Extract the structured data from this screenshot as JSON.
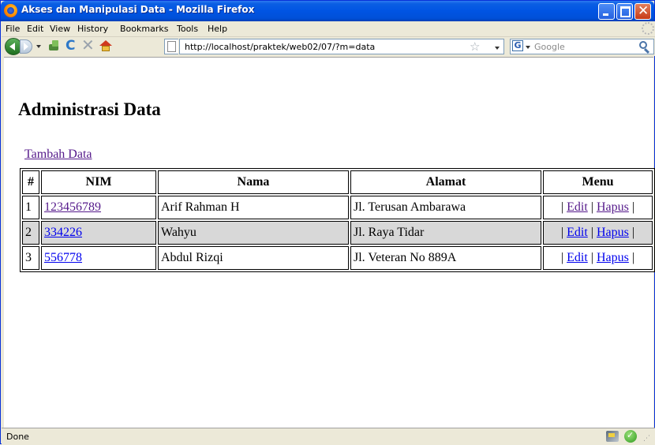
{
  "window": {
    "title": "Akses dan Manipulasi Data - Mozilla Firefox"
  },
  "menubar": [
    "File",
    "Edit",
    "View",
    "History",
    "Bookmarks",
    "Tools",
    "Help"
  ],
  "navbar": {
    "url": "http://localhost/praktek/web02/07/?m=data",
    "search_placeholder": "Google"
  },
  "page": {
    "heading": "Administrasi Data",
    "add_link": "Tambah Data",
    "table": {
      "headers": [
        "#",
        "NIM",
        "Nama",
        "Alamat",
        "Menu"
      ],
      "rows": [
        {
          "no": "1",
          "nim": "123456789",
          "nama": "Arif Rahman H",
          "alamat": "Jl. Terusan Ambarawa"
        },
        {
          "no": "2",
          "nim": "334226",
          "nama": "Wahyu",
          "alamat": "Jl. Raya Tidar"
        },
        {
          "no": "3",
          "nim": "556778",
          "nama": "Abdul Rizqi",
          "alamat": "Jl. Veteran No 889A"
        }
      ],
      "edit_label": "Edit",
      "delete_label": "Hapus",
      "separator": "|"
    }
  },
  "status": {
    "text": "Done"
  },
  "icons": {
    "firefox": "firefox-icon",
    "back": "back-arrow-icon",
    "forward": "forward-arrow-icon",
    "bookmark": "bookmark-icon",
    "reload": "reload-icon",
    "stop": "stop-icon",
    "home": "home-icon",
    "star": "star-icon",
    "google": "google-icon",
    "search": "magnifier-icon",
    "secure": "check-icon"
  },
  "colors": {
    "titlebar": "#0054e3",
    "visited_link": "#551a8b",
    "link": "#0000ee",
    "alt_row": "#d8d8d8"
  }
}
